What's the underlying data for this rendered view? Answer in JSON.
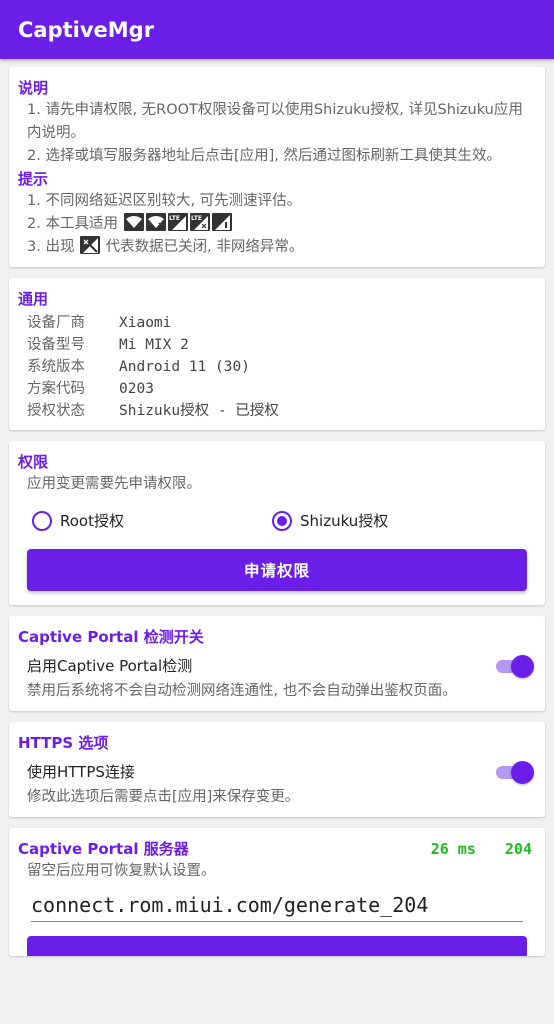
{
  "app": {
    "title": "CaptiveMgr"
  },
  "instructions": {
    "title": "说明",
    "lines": [
      "1. 请先申请权限, 无ROOT权限设备可以使用Shizuku授权, 详见Shizuku应用内说明。",
      "2. 选择或填写服务器地址后点击[应用], 然后通过图标刷新工具使其生效。"
    ],
    "tips_title": "提示",
    "tip1": "1. 不同网络延迟区别较大, 可先测速评估。",
    "tip2_prefix": "2. 本工具适用",
    "tip3_prefix": "3. 出现",
    "tip3_suffix": "代表数据已关闭, 非网络异常。",
    "tip2_icons": [
      "wifi-warning-icon",
      "wifi-x-icon",
      "lte-signal-warning-icon",
      "lte-signal-x-icon",
      "signal-warning-icon"
    ],
    "tip3_icon": "signal-off-icon"
  },
  "general": {
    "title": "通用",
    "rows": [
      {
        "k": "设备厂商",
        "v": "Xiaomi"
      },
      {
        "k": "设备型号",
        "v": "Mi MIX 2"
      },
      {
        "k": "系统版本",
        "v": "Android 11 (30)"
      },
      {
        "k": "方案代码",
        "v": "0203"
      },
      {
        "k": "授权状态",
        "v": "Shizuku授权 - 已授权"
      }
    ]
  },
  "permission": {
    "title": "权限",
    "desc": "应用变更需要先申请权限。",
    "options": [
      {
        "label": "Root授权",
        "selected": false
      },
      {
        "label": "Shizuku授权",
        "selected": true
      }
    ],
    "button": "申请权限"
  },
  "captive_switch": {
    "title": "Captive Portal 检测开关",
    "label": "启用Captive Portal检测",
    "enabled": true,
    "desc": "禁用后系统将不会自动检测网络连通性, 也不会自动弹出鉴权页面。"
  },
  "https": {
    "title": "HTTPS 选项",
    "label": "使用HTTPS连接",
    "enabled": true,
    "desc": "修改此选项后需要点击[应用]来保存变更。"
  },
  "server": {
    "title": "Captive Portal 服务器",
    "latency": "26 ms",
    "status_code": "204",
    "desc": "留空后应用可恢复默认设置。",
    "value": "connect.rom.miui.com/generate_204"
  },
  "colors": {
    "primary": "#6a1ee8",
    "success": "#22bb22"
  }
}
